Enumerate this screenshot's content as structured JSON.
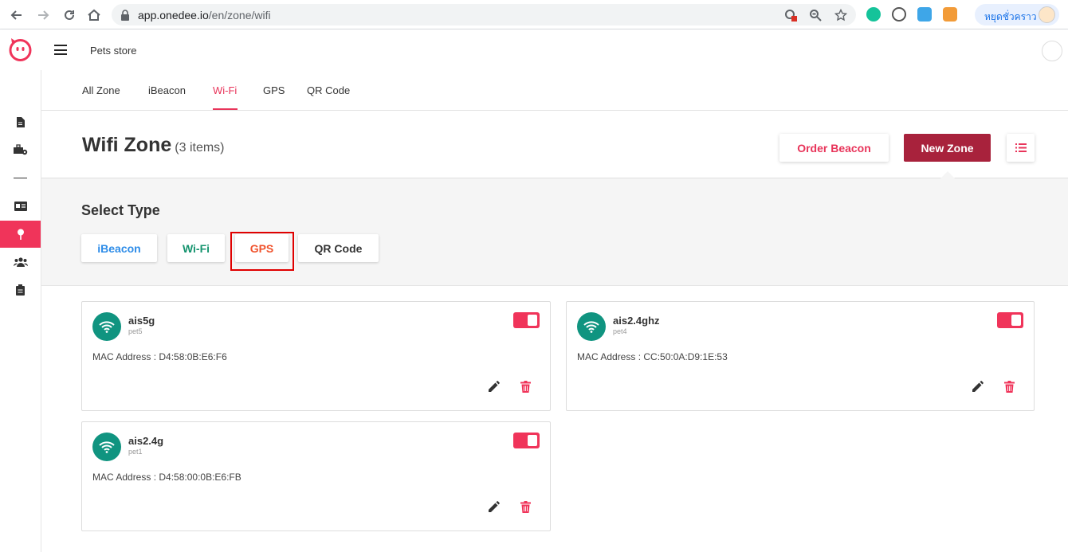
{
  "browser": {
    "url_host": "app.onedee.io",
    "url_path": "/en/zone/wifi",
    "profile_label": "หยุดชั่วคราว"
  },
  "header": {
    "store_name": "Pets store"
  },
  "tabs": [
    {
      "label": "All Zone"
    },
    {
      "label": "iBeacon"
    },
    {
      "label": "Wi-Fi"
    },
    {
      "label": "GPS"
    },
    {
      "label": "QR Code"
    }
  ],
  "page": {
    "title": "Wifi Zone",
    "count": "(3 items)",
    "order_button": "Order Beacon",
    "new_button": "New Zone"
  },
  "select_type": {
    "title": "Select Type",
    "options": [
      {
        "label": "iBeacon",
        "color": "#2d8ce8"
      },
      {
        "label": "Wi-Fi",
        "color": "#16946f"
      },
      {
        "label": "GPS",
        "color": "#f0522c"
      },
      {
        "label": "QR Code",
        "color": "#333333"
      }
    ]
  },
  "zones": [
    {
      "name": "ais5g",
      "sub": "pet5",
      "mac": "MAC Address : D4:58:0B:E6:F6",
      "enabled": true
    },
    {
      "name": "ais2.4ghz",
      "sub": "pet4",
      "mac": "MAC Address : CC:50:0A:D9:1E:53",
      "enabled": true
    },
    {
      "name": "ais2.4g",
      "sub": "pet1",
      "mac": "MAC Address : D4:58:00:0B:E6:FB",
      "enabled": true
    }
  ],
  "colors": {
    "accent": "#f0345a",
    "primary_button": "#a8223c",
    "wifi_avatar": "#109480"
  }
}
